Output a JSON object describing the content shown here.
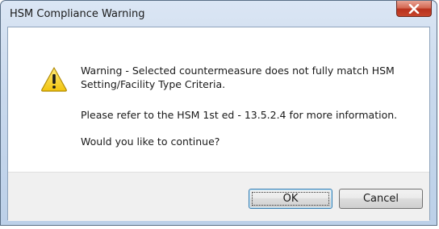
{
  "window": {
    "title": "HSM Compliance Warning",
    "close_icon": "close-icon"
  },
  "message": {
    "icon": "warning-icon",
    "line1": "Warning - Selected countermeasure does not fully match HSM Setting/Facility Type Criteria.",
    "line2": "Please refer to the HSM 1st ed - 13.5.2.4 for more information.",
    "line3": "Would you like to continue?"
  },
  "buttons": {
    "ok_label": "OK",
    "cancel_label": "Cancel"
  },
  "colors": {
    "title_bar": "#c9d9ed",
    "close_button": "#c7442b",
    "warning_icon": "#f7d21b",
    "default_button_border": "#3c7fb1"
  }
}
